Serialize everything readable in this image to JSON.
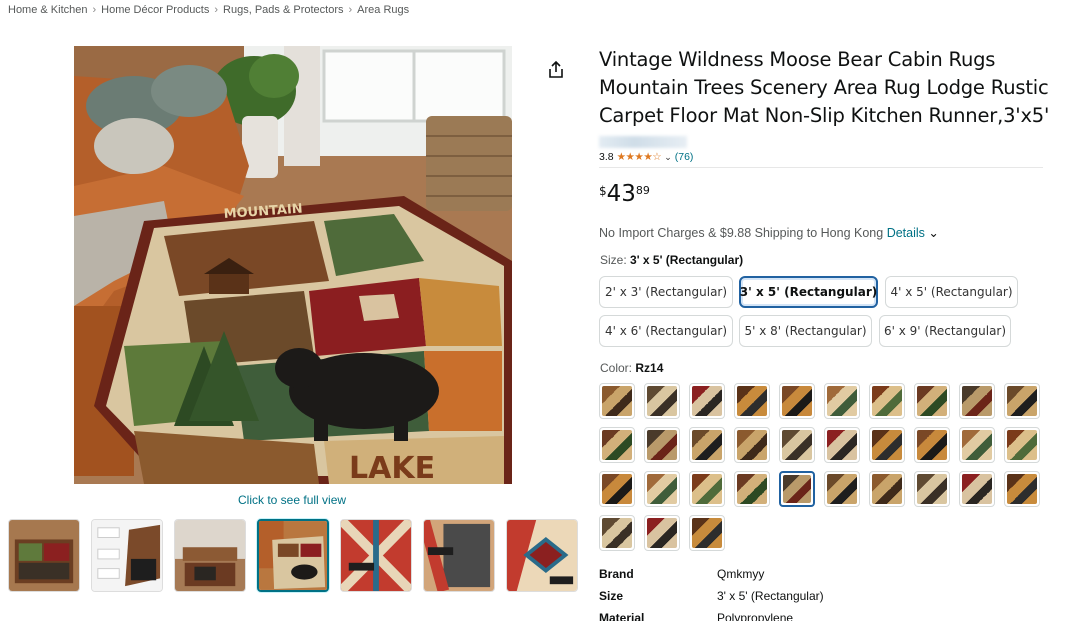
{
  "breadcrumb": [
    {
      "label": "Home & Kitchen"
    },
    {
      "label": "Home Décor Products"
    },
    {
      "label": "Rugs, Pads & Protectors"
    },
    {
      "label": "Area Rugs"
    }
  ],
  "breadcrumb_separator": "›",
  "product": {
    "title": "Vintage Wildness Moose Bear Cabin Rugs Mountain Trees Scenery Area Rug Lodge Rustic Carpet Floor Mat Non-Slip Kitchen Runner,3'x5'",
    "rating": "3.8",
    "stars": "★★★★☆",
    "rating_chevron": "⌄",
    "review_count": "(76)",
    "price_currency": "$",
    "price_whole": "43",
    "price_fraction": "89",
    "shipping_text": "No Import Charges & $9.88 Shipping to Hong Kong",
    "shipping_details": "Details",
    "shipping_chevron": "⌄"
  },
  "gallery": {
    "main_image_text_top": "MOUNTAIN",
    "main_image_text_bottom": "LAKE",
    "click_full_view": "Click to see full view",
    "share_icon": "share-icon",
    "thumbnail_count": 7,
    "selected_thumbnail_index": 3
  },
  "size": {
    "label": "Size:",
    "selected": "3' x 5' (Rectangular)",
    "options": [
      "2' x 3' (Rectangular)",
      "3' x 5' (Rectangular)",
      "4' x 5' (Rectangular)",
      "4' x 6' (Rectangular)",
      "5' x 8' (Rectangular)",
      "6' x 9' (Rectangular)"
    ],
    "selected_index": 1
  },
  "color": {
    "label": "Color:",
    "selected": "Rz14",
    "swatch_count": 33,
    "selected_index": 24
  },
  "specs": [
    {
      "key": "Brand",
      "value": "Qmkmyy"
    },
    {
      "key": "Size",
      "value": "3' x 5' (Rectangular)"
    },
    {
      "key": "Material",
      "value": "Polypropylene"
    }
  ],
  "colors": {
    "link": "#007185",
    "accent_border": "#2162a1",
    "star": "#de7921",
    "text": "#0f1111",
    "muted": "#565959"
  }
}
